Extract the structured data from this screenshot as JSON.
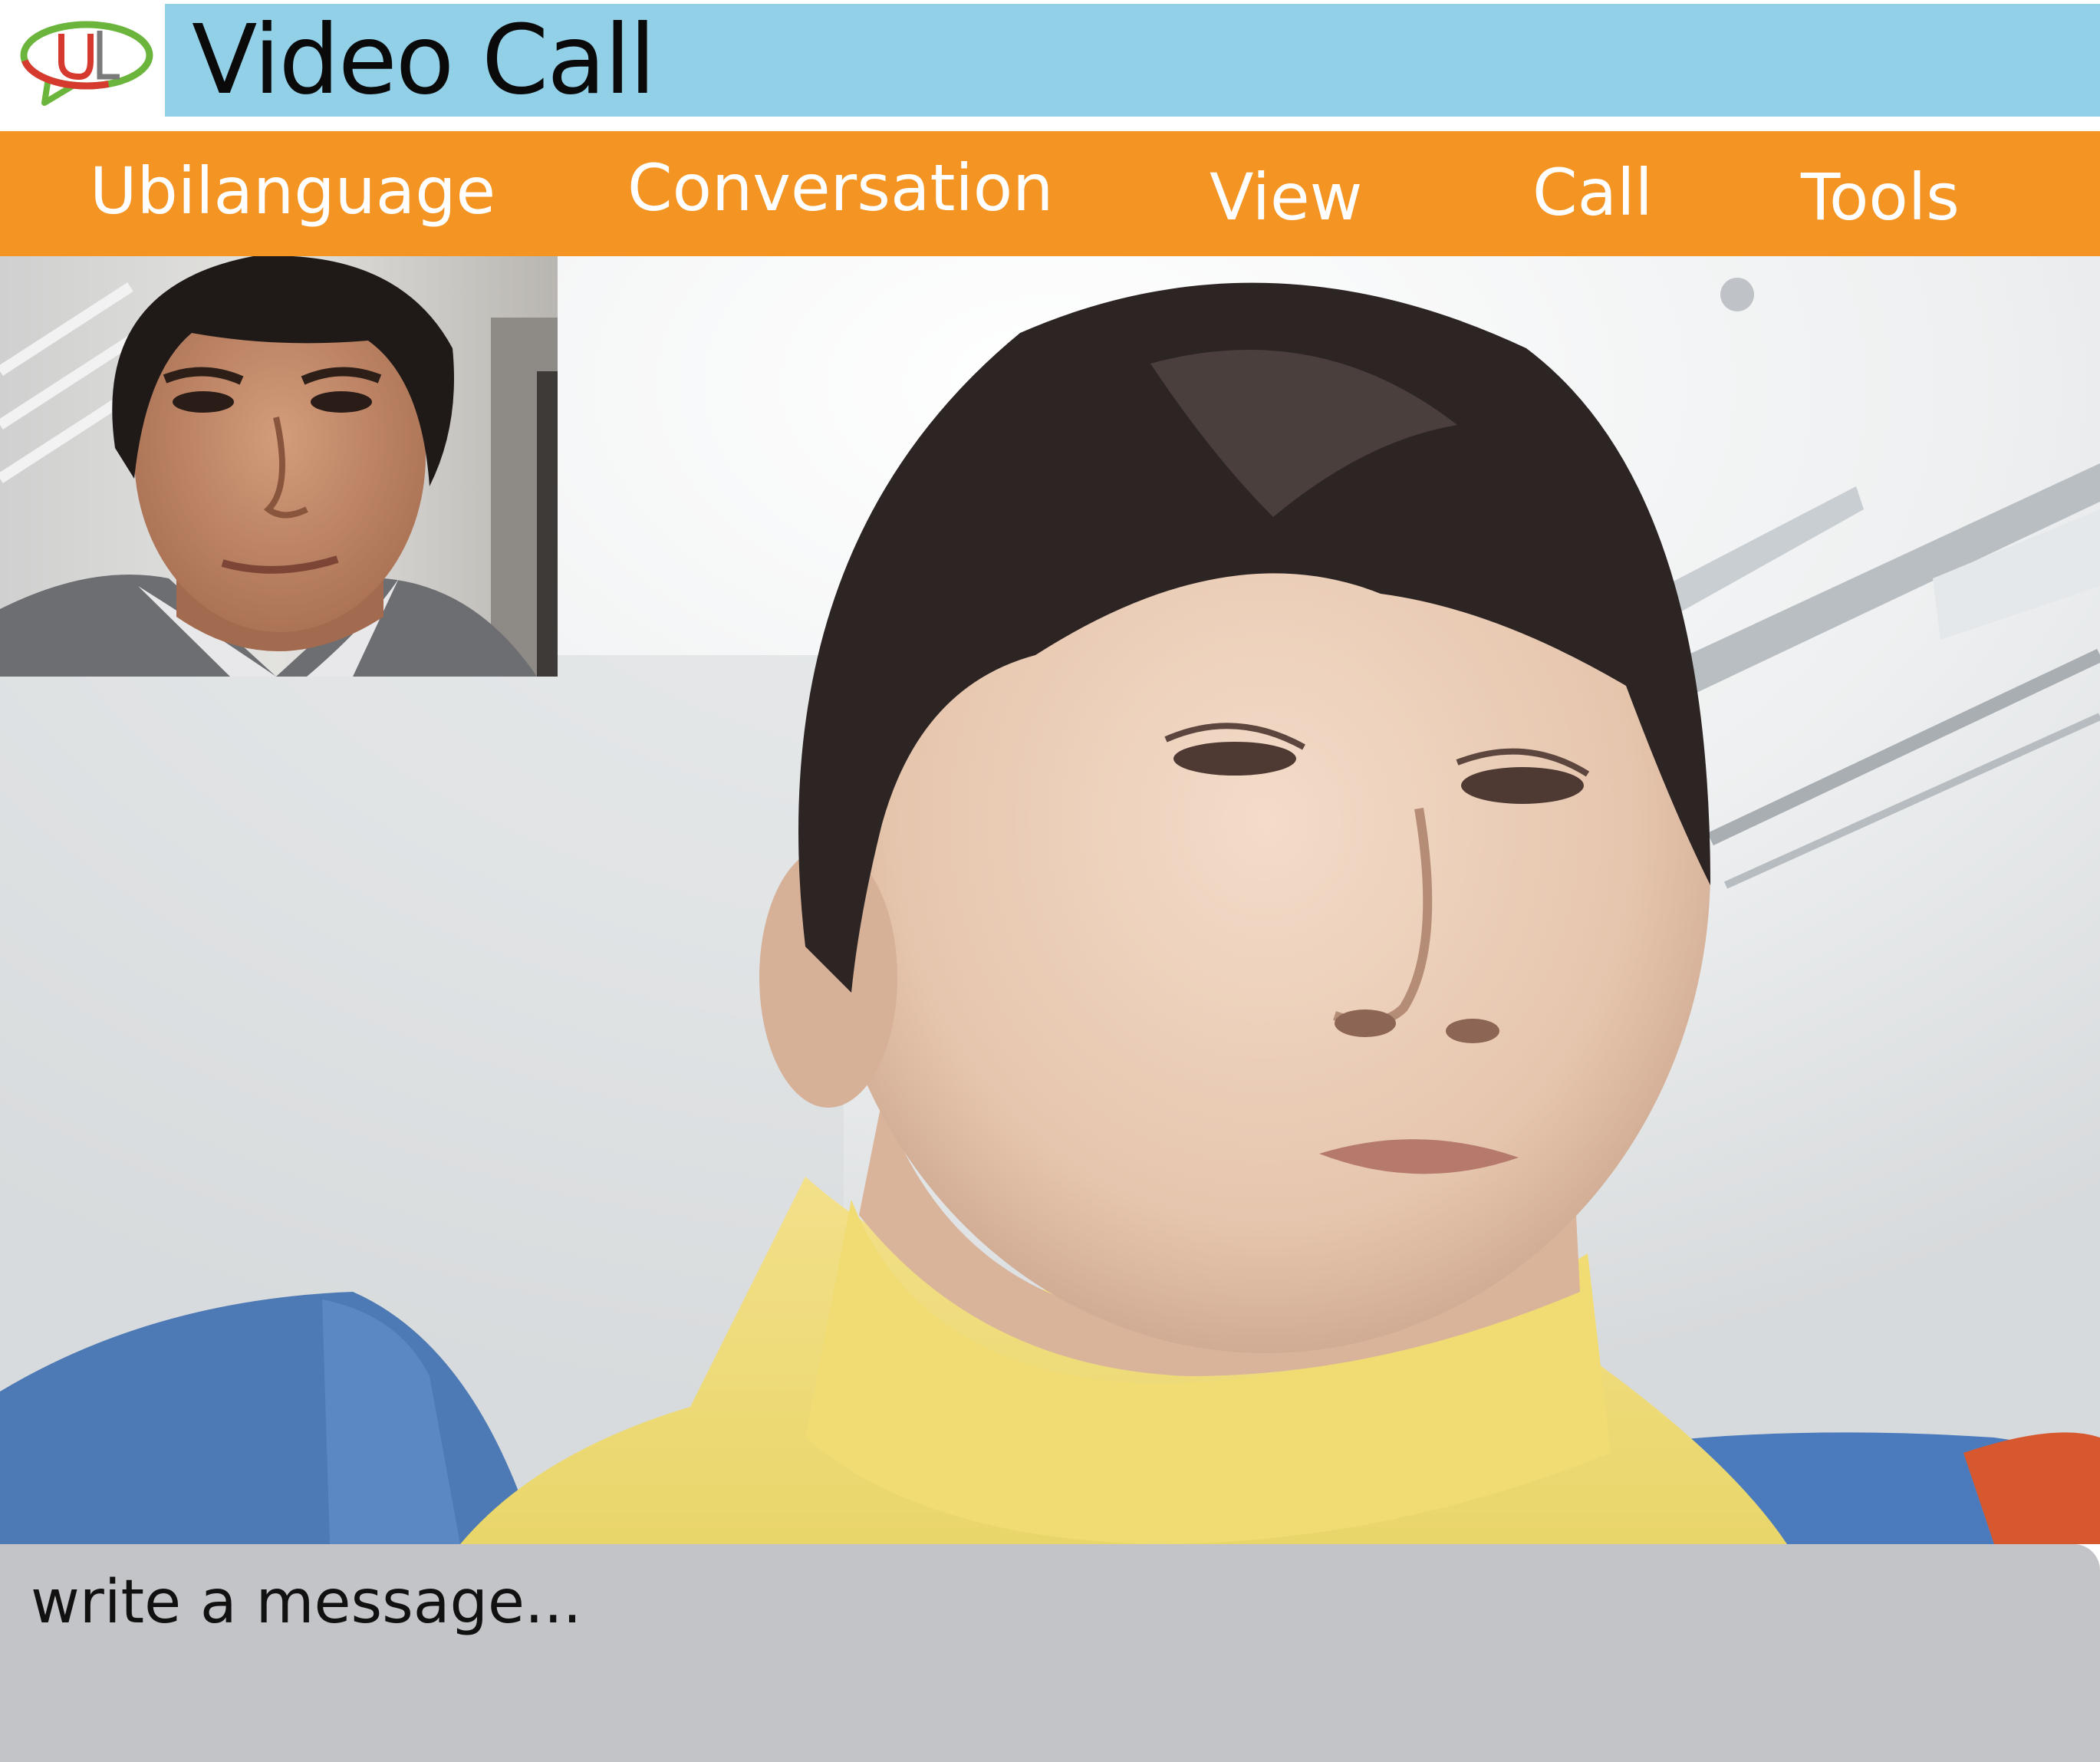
{
  "app": {
    "title": "Video Call",
    "logo_text": "UL"
  },
  "menu": {
    "items": [
      "Ubilanguage",
      "Conversation",
      "View",
      "Call",
      "Tools"
    ]
  },
  "message": {
    "placeholder": "write a message..."
  },
  "colors": {
    "title_bar": "#92d0e8",
    "menu_bar": "#f39423",
    "message_area": "#c3c4c8",
    "logo_red": "#d63a2f",
    "logo_green": "#6bb53c"
  }
}
